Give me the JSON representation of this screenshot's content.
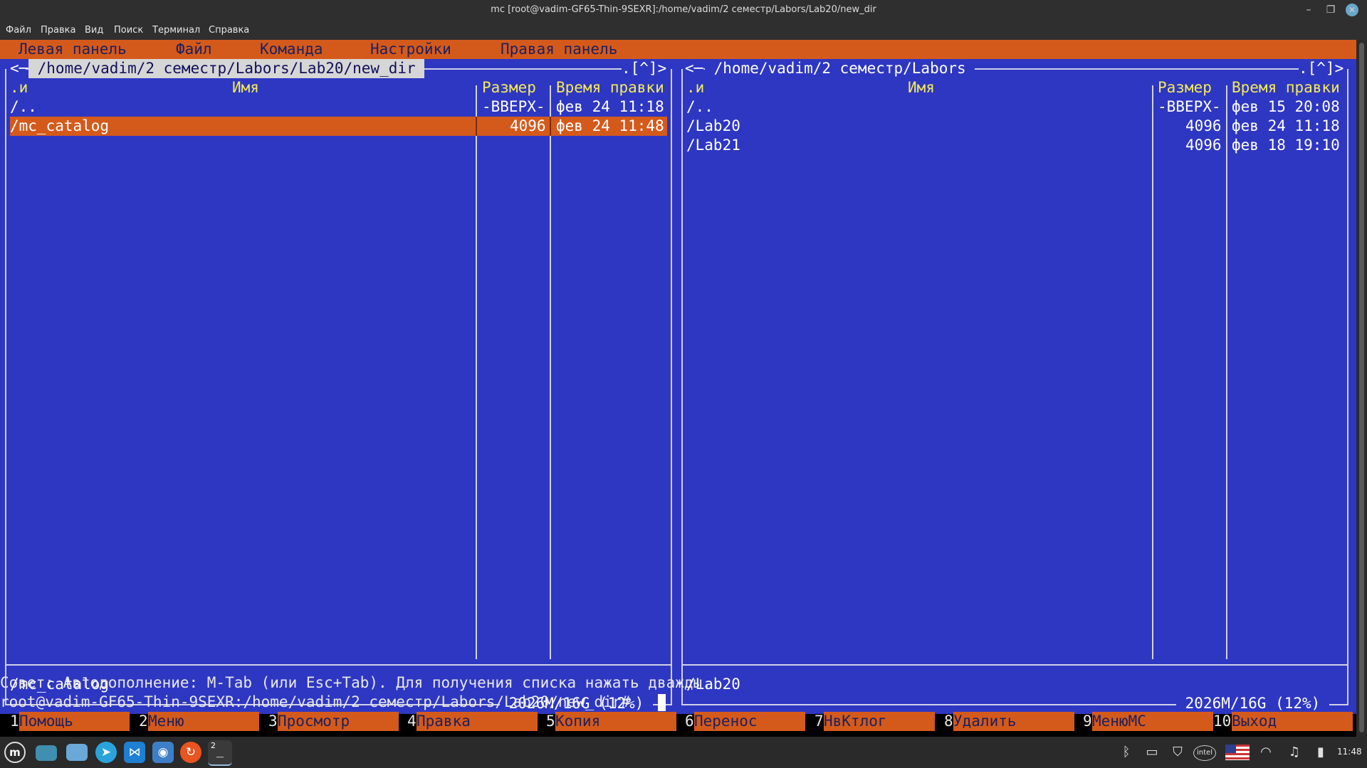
{
  "window": {
    "title": "mc [root@vadim-GF65-Thin-9SEXR]:/home/vadim/2 семестр/Labors/Lab20/new_dir",
    "min": "–",
    "max": "❐",
    "close": "✕"
  },
  "terminal_menu": [
    "Файл",
    "Правка",
    "Вид",
    "Поиск",
    "Терминал",
    "Справка"
  ],
  "mc_menu": [
    "Левая панель",
    "Файл",
    "Команда",
    "Настройки",
    "Правая панель"
  ],
  "left_panel": {
    "frame_left": "<─",
    "path": " /home/vadim/2 семестр/Labors/Lab20/new_dir ",
    "frame_right": ".[^]>",
    "headers": {
      "marker": ".и",
      "name": "Имя",
      "size": "Размер",
      "time": "Время правки"
    },
    "rows": [
      {
        "name": "/..",
        "size": "-ВВЕРХ-",
        "time": "фев 24 11:18",
        "selected": false
      },
      {
        "name": "/mc_catalog",
        "size": "4096",
        "time": "фев 24 11:48",
        "selected": true
      }
    ],
    "mini_status": "/mc_catalog",
    "disk": " 2026M/16G (12%) "
  },
  "right_panel": {
    "frame_left": "<─",
    "path": " /home/vadim/2 семестр/Labors ",
    "frame_right": ".[^]>",
    "headers": {
      "marker": ".и",
      "name": "Имя",
      "size": "Размер",
      "time": "Время правки"
    },
    "rows": [
      {
        "name": "/..",
        "size": "-ВВЕРХ-",
        "time": "фев 15 20:08",
        "selected": false
      },
      {
        "name": "/Lab20",
        "size": "4096",
        "time": "фев 24 11:18",
        "selected": false
      },
      {
        "name": "/Lab21",
        "size": "4096",
        "time": "фев 18 19:10",
        "selected": false
      }
    ],
    "mini_status": "/Lab20",
    "disk": " 2026M/16G (12%) "
  },
  "hint": "Совет: Автодополнение: M-Tab (или Esc+Tab). Для получения списка нажать дважды.",
  "prompt": "root@vadim-GF65-Thin-9SEXR:/home/vadim/2 семестр/Labors/Lab20/new_dir#",
  "function_keys": [
    {
      "num": "1",
      "label": "Помощь"
    },
    {
      "num": "2",
      "label": "Меню"
    },
    {
      "num": "3",
      "label": "Просмотр"
    },
    {
      "num": "4",
      "label": "Правка"
    },
    {
      "num": "5",
      "label": "Копия"
    },
    {
      "num": "6",
      "label": "Перенос"
    },
    {
      "num": "7",
      "label": "НвКтлог"
    },
    {
      "num": "8",
      "label": "Удалить"
    },
    {
      "num": "9",
      "label": "МенюМС"
    },
    {
      "num": "10",
      "label": "Выход"
    }
  ],
  "taskbar": {
    "apps": [
      "mint-menu-icon",
      "show-desktop-icon",
      "files-icon",
      "telegram-icon",
      "vscode-icon",
      "screenshot-icon",
      "ubuntu-icon",
      "terminal-icon"
    ],
    "terminal_badge": "2",
    "tray": [
      "bluetooth-icon",
      "clipboard-icon",
      "shield-icon",
      "intel-icon",
      "us-flag-icon",
      "wifi-icon",
      "music-icon",
      "battery-icon"
    ],
    "intel_label": "intel",
    "clock": "11:48"
  },
  "colors": {
    "panel_bg": "#2e37c2",
    "accent": "#d45a1c",
    "header_yellow": "#f3ea5a"
  }
}
